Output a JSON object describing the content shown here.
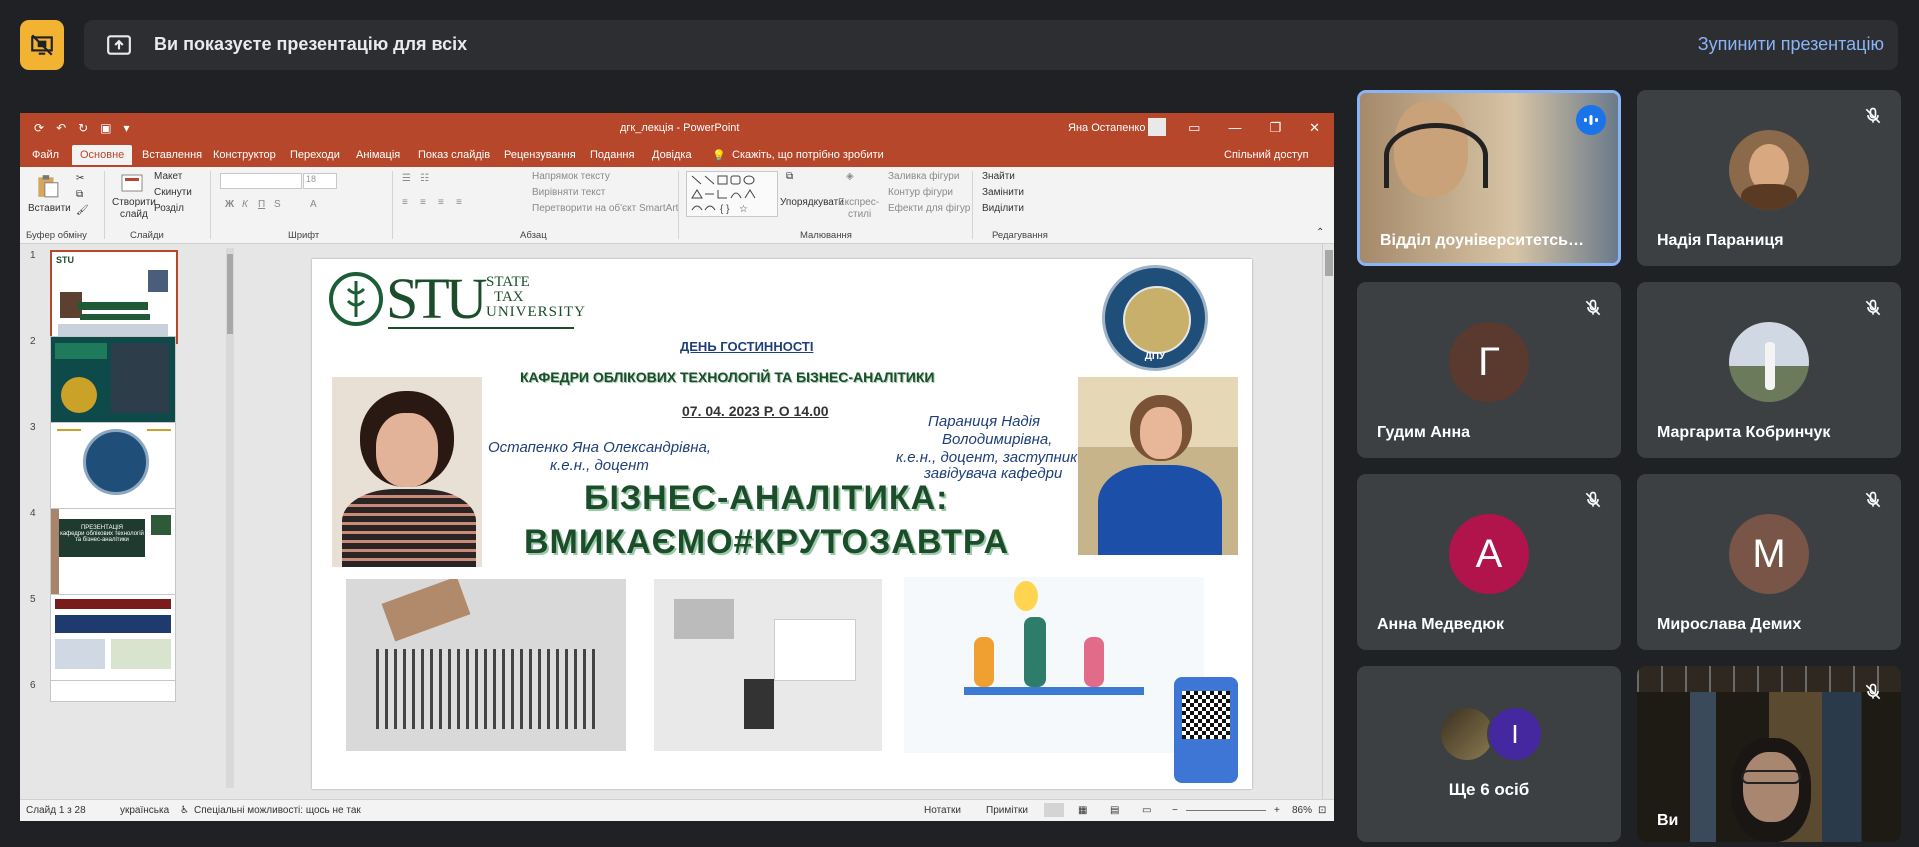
{
  "banner": {
    "message": "Ви показуєте презентацію для всіх",
    "stop_label": "Зупинити презентацію"
  },
  "ppt": {
    "window_title": "дгк_лекція - PowerPoint",
    "user_name": "Яна Остапенко",
    "tabs": [
      "Файл",
      "Основне",
      "Вставлення",
      "Конструктор",
      "Переходи",
      "Анімація",
      "Показ слайдів",
      "Рецензування",
      "Подання",
      "Довідка"
    ],
    "tell_me": "Скажіть, що потрібно зробити",
    "share": "Спільний доступ",
    "ribbon": {
      "paste": "Вставити",
      "new_slide_1": "Створити",
      "new_slide_2": "слайд",
      "layout": "Макет",
      "reset": "Скинути",
      "section": "Розділ",
      "font_size": "18",
      "text_direction": "Напрямок тексту",
      "align_text": "Вирівняти текст",
      "smartart": "Перетворити на об'єкт SmartArt",
      "arrange": "Упорядкувати",
      "quick_styles_1": "Експрес-",
      "quick_styles_2": "стилі",
      "shape_fill": "Заливка фігури",
      "shape_outline": "Контур фігури",
      "shape_effects": "Ефекти для фігур",
      "find": "Знайти",
      "replace": "Замінити",
      "select": "Виділити",
      "groups": [
        "Буфер обміну",
        "Слайди",
        "Шрифт",
        "Абзац",
        "Малювання",
        "Редагування"
      ]
    },
    "thumbnails": [
      "1",
      "2",
      "3",
      "4",
      "5",
      "6"
    ],
    "thumb4_title": "ПРЕЗЕНТАЦІЯ",
    "thumb4_sub": "кафедри облікових технологій та бізнес-аналітики",
    "status": {
      "slide_info": "Слайд 1 з 28",
      "language": "українська",
      "accessibility": "Спеціальні можливості: щось не так",
      "notes": "Нотатки",
      "comments": "Примітки",
      "zoom": "86%"
    }
  },
  "slide": {
    "logo_stu": "STU",
    "logo_line1": "STATE",
    "logo_line2": "TAX",
    "logo_line3": "UNIVERSITY",
    "hospitality_day": "ДЕНЬ ГОСТИННОСТІ",
    "department": "КАФЕДРИ ОБЛІКОВИХ ТЕХНОЛОГІЙ  ТА БІЗНЕС-АНАЛІТИКИ",
    "date": "07. 04. 2023 Р. О 14.00",
    "person1_line1": "Остапенко Яна Олександрівна,",
    "person1_line2": "к.е.н., доцент",
    "person2_line1": "Параниця Надія",
    "person2_line2": "Володимирівна,",
    "person2_line3": "к.е.н., доцент, заступник",
    "person2_line4": "завідувача кафедри",
    "headline1": "БІЗНЕС-АНАЛІТИКА:",
    "headline2": "ВМИКАЄМО#КРУТОЗАВТРА",
    "seal_text": "ДПУ"
  },
  "participants": [
    {
      "name": "Відділ доуніверситетсь…",
      "initial": "",
      "color": "",
      "speaking": true
    },
    {
      "name": "Надія Параниця",
      "initial": "",
      "color": "",
      "muted": true
    },
    {
      "name": "Гудим Анна",
      "initial": "Г",
      "color": "#5a3a2f",
      "muted": true
    },
    {
      "name": "Маргарита Кобринчук",
      "initial": "",
      "color": "",
      "muted": true
    },
    {
      "name": "Анна Медведюк",
      "initial": "А",
      "color": "#b0144b",
      "muted": true
    },
    {
      "name": "Мирослава Демих",
      "initial": "М",
      "color": "#795548",
      "muted": true
    },
    {
      "name": "Ще 6 осіб",
      "initial": "І",
      "color": "#4527a0"
    },
    {
      "name": "Ви",
      "initial": "",
      "color": "",
      "muted": true
    }
  ],
  "colors": {
    "accent": "#8ab4f8",
    "ppt_brand": "#b7472a",
    "present_tile": "#f2b232"
  }
}
